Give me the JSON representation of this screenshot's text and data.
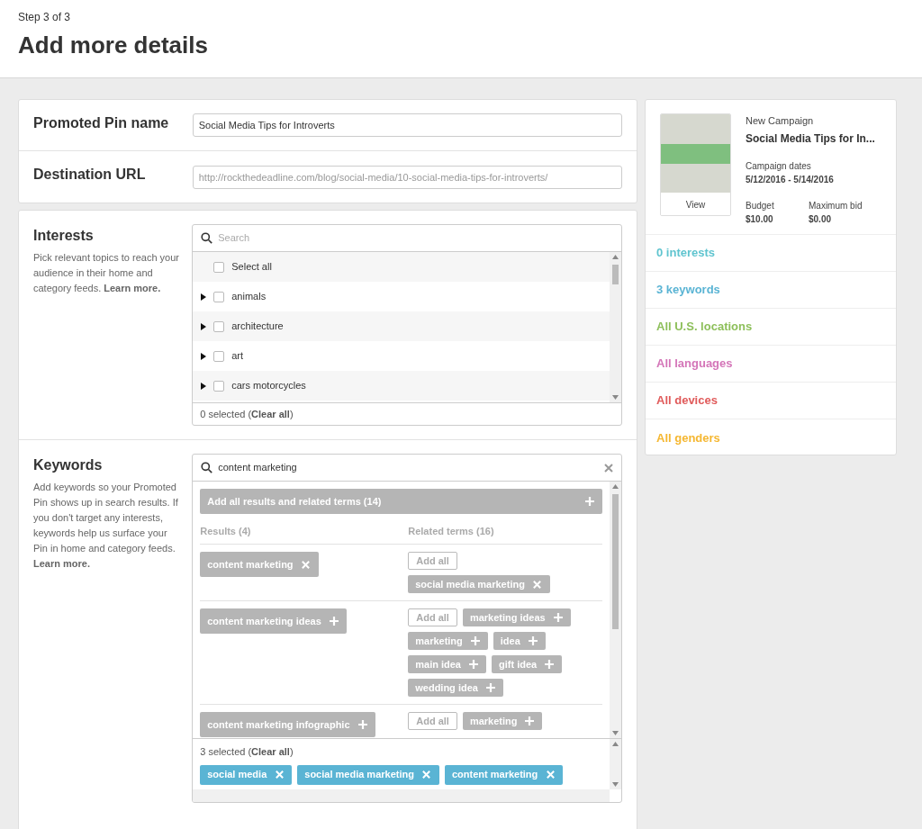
{
  "header": {
    "step": "Step 3 of 3",
    "title": "Add more details"
  },
  "pin_name": {
    "label": "Promoted Pin name",
    "value": "Social Media Tips for Introverts"
  },
  "destination": {
    "label": "Destination URL",
    "placeholder": "http://rockthedeadline.com/blog/social-media/10-social-media-tips-for-introverts/"
  },
  "interests": {
    "title": "Interests",
    "description": "Pick relevant topics to reach your audience in their home and category feeds. **Learn more.**",
    "search_placeholder": "Search",
    "items": [
      {
        "kind": "select_all",
        "label": "Select all",
        "checked": false
      },
      {
        "kind": "category",
        "label": "animals",
        "checked": false,
        "expanded": false
      },
      {
        "kind": "category",
        "label": "architecture",
        "checked": false,
        "expanded": false
      },
      {
        "kind": "category",
        "label": "art",
        "checked": false,
        "expanded": false
      },
      {
        "kind": "category",
        "label": "cars motorcycles",
        "checked": false,
        "expanded": false
      }
    ],
    "footer": "0 selected (**Clear all**)"
  },
  "keywords": {
    "title": "Keywords",
    "description": "Add keywords so your Promoted Pin shows up in search results. If you don't target any interests, keywords help us surface your Pin in home and category feeds. **Learn more.**",
    "search_value": "content marketing",
    "add_all_button": "Add all results and related terms (14)",
    "results_heading": "Results (4)",
    "related_heading": "Related terms (16)",
    "groups": [
      {
        "result": {
          "label": "content marketing",
          "kind": "remove"
        },
        "add_all": "Add all",
        "related": [
          {
            "label": "social media marketing",
            "kind": "remove"
          }
        ]
      },
      {
        "result": {
          "label": "content marketing ideas",
          "kind": "add"
        },
        "add_all": "Add all",
        "related": [
          {
            "label": "marketing ideas",
            "kind": "add"
          },
          {
            "label": "marketing",
            "kind": "add"
          },
          {
            "label": "idea",
            "kind": "add"
          },
          {
            "label": "main idea",
            "kind": "add"
          },
          {
            "label": "gift idea",
            "kind": "add"
          },
          {
            "label": "wedding idea",
            "kind": "add"
          }
        ]
      },
      {
        "result": {
          "label": "content marketing infographic",
          "kind": "add"
        },
        "add_all": "Add all",
        "related": [
          {
            "label": "marketing",
            "kind": "add"
          }
        ]
      }
    ],
    "footer": "3 selected (**Clear all**)",
    "selected": [
      {
        "label": "social media"
      },
      {
        "label": "social media marketing"
      },
      {
        "label": "content marketing"
      }
    ]
  },
  "summary": {
    "view_button": "View",
    "campaign_label": "New Campaign",
    "pin_title": "Social Media Tips for In...",
    "dates_label": "Campaign dates",
    "dates": "5/12/2016 - 5/14/2016",
    "budget_label": "Budget",
    "budget": "$10.00",
    "bid_label": "Maximum bid",
    "bid": "$0.00",
    "targets": [
      {
        "label": "0 interests",
        "color": "#5fc4cf"
      },
      {
        "label": "3 keywords",
        "color": "#5ab4d4"
      },
      {
        "label": "All U.S. locations",
        "color": "#8dbf5a"
      },
      {
        "label": "All languages",
        "color": "#d475b8"
      },
      {
        "label": "All devices",
        "color": "#e05a5a"
      },
      {
        "label": "All genders",
        "color": "#f5b731"
      }
    ]
  }
}
